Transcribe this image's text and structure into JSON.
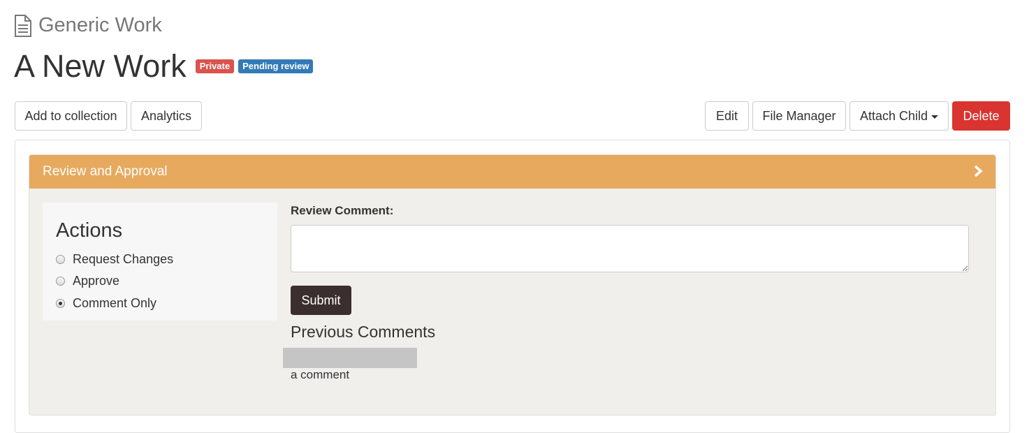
{
  "header": {
    "doc_type_icon": "document-icon",
    "doc_type": "Generic Work",
    "title": "A New Work",
    "badges": [
      {
        "label": "Private",
        "color": "#d9534f"
      },
      {
        "label": "Pending review",
        "color": "#337ab7"
      }
    ]
  },
  "toolbar": {
    "add_to_collection": "Add to collection",
    "analytics": "Analytics",
    "edit": "Edit",
    "file_manager": "File Manager",
    "attach_child": "Attach Child",
    "delete": "Delete"
  },
  "review_panel": {
    "heading": "Review and Approval",
    "heading_color": "#e6a95e",
    "actions": {
      "title": "Actions",
      "options": [
        {
          "label": "Request Changes",
          "checked": false
        },
        {
          "label": "Approve",
          "checked": false
        },
        {
          "label": "Comment Only",
          "checked": true
        }
      ]
    },
    "review_comment": {
      "label": "Review Comment:",
      "value": ""
    },
    "submit_label": "Submit",
    "previous_comments": {
      "title": "Previous Comments",
      "comments": [
        {
          "author": "",
          "text": "a comment"
        }
      ]
    }
  },
  "colors": {
    "delete": "#d9342f",
    "submit": "#3b2e2e",
    "panel_background": "#f0efeb"
  }
}
